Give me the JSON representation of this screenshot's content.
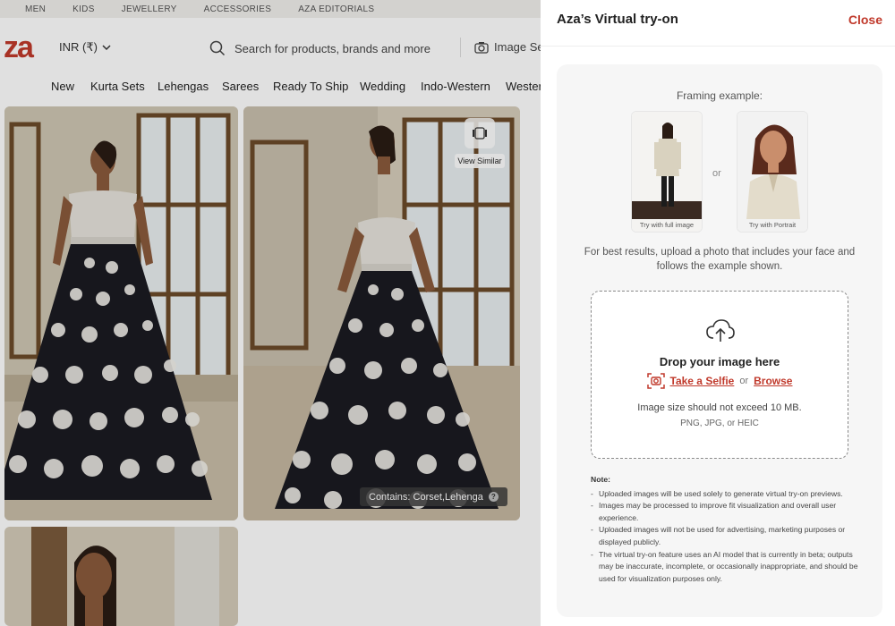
{
  "site": {
    "top_nav": [
      "MEN",
      "KIDS",
      "JEWELLERY",
      "ACCESSORIES",
      "AZA EDITORIALS"
    ],
    "logo_text": "za",
    "currency": "INR (₹)",
    "search_placeholder": "Search for products, brands and more",
    "image_search_label": "Image Se",
    "categories": [
      "New",
      "Kurta Sets",
      "Lehengas",
      "Sarees",
      "Ready To Ship",
      "Wedding",
      "Indo-Western",
      "Wester"
    ],
    "view_similar": "View Similar",
    "contains": "Contains: Corset,Lehenga",
    "contains_help": "?"
  },
  "panel": {
    "title": "Aza’s Virtual try-on",
    "close": "Close",
    "framing_label": "Framing example:",
    "example_full": "Try with full image",
    "example_portrait": "Try with Portrait",
    "or": "or",
    "hint": "For best results, upload a photo that includes your face and follows the example shown.",
    "drop_title": "Drop your image here",
    "selfie": "Take a Selfie",
    "browse": "Browse",
    "size_limit": "Image size should not exceed 10 MB.",
    "formats": "PNG, JPG, or HEIC",
    "note_title": "Note:",
    "notes": [
      "Uploaded images will be used solely to generate virtual try-on previews.",
      "Images may be processed to improve fit visualization and overall user experience.",
      "Uploaded images will not be used for advertising, marketing purposes or displayed publicly.",
      "The virtual try-on feature uses an AI model that is currently in beta; outputs may be inaccurate, incomplete, or occasionally inappropriate, and should be used for visualization purposes only."
    ]
  },
  "colors": {
    "accent": "#c0392b",
    "card_bg": "#f6f6f6"
  }
}
